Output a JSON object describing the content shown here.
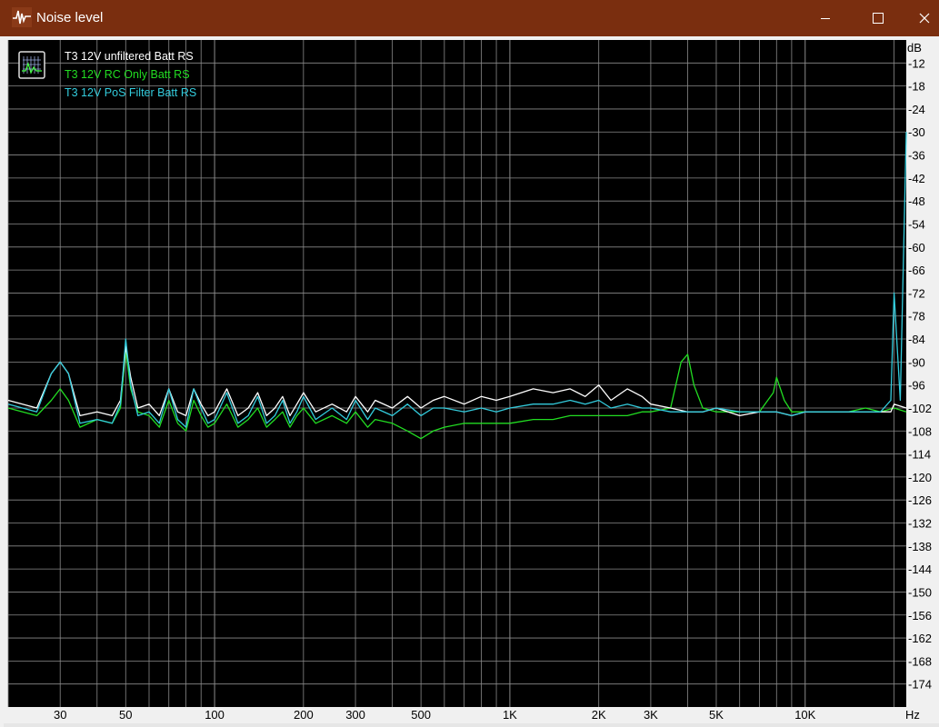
{
  "window": {
    "title": "Noise level",
    "minimize_glyph": "minimize-icon",
    "maximize_glyph": "maximize-icon",
    "close_glyph": "close-icon",
    "app_icon": "waveform-icon"
  },
  "colors": {
    "titlebar": "#7a2e0f",
    "plot_bg": "#000000",
    "grid": "#8a8a8a",
    "unfiltered": "#ffffff",
    "rc_only": "#22dd22",
    "pos_filter": "#33ccdd"
  },
  "chart_data": {
    "type": "line",
    "title": "",
    "xscale": "log",
    "xlim": [
      20,
      22000
    ],
    "ylim": [
      -180,
      -6
    ],
    "xunit": "Hz",
    "yunit": "dB",
    "legend_position": "top-left",
    "grid": true,
    "x_ticks": [
      30,
      50,
      100,
      200,
      300,
      500,
      1000,
      2000,
      3000,
      5000,
      10000
    ],
    "x_tick_labels": [
      "30",
      "50",
      "100",
      "200",
      "300",
      "500",
      "1K",
      "2K",
      "3K",
      "5K",
      "10K"
    ],
    "y_ticks": [
      -12,
      -18,
      -24,
      -30,
      -36,
      -42,
      -48,
      -54,
      -60,
      -66,
      -72,
      -78,
      -84,
      -90,
      -96,
      -102,
      -108,
      -114,
      -120,
      -126,
      -132,
      -138,
      -144,
      -150,
      -156,
      -162,
      -168,
      -174
    ],
    "series": [
      {
        "name": "T3 12V unfiltered Batt RS",
        "color": "#ffffff",
        "x": [
          20,
          25,
          28,
          30,
          32,
          35,
          40,
          45,
          48,
          50,
          52,
          55,
          60,
          65,
          70,
          75,
          80,
          85,
          90,
          95,
          100,
          110,
          120,
          130,
          140,
          150,
          160,
          170,
          180,
          190,
          200,
          220,
          250,
          280,
          300,
          330,
          350,
          400,
          450,
          500,
          550,
          600,
          700,
          800,
          900,
          1000,
          1200,
          1400,
          1600,
          1800,
          2000,
          2200,
          2500,
          2800,
          3000,
          3500,
          4000,
          4500,
          5000,
          6000,
          7000,
          8000,
          9000,
          10000,
          12000,
          14000,
          16000,
          18000,
          19500,
          20000,
          22000
        ],
        "y": [
          -100,
          -102,
          -93,
          -90,
          -93,
          -104,
          -103,
          -104,
          -100,
          -86,
          -94,
          -102,
          -101,
          -104,
          -97,
          -103,
          -104,
          -97,
          -101,
          -104,
          -103,
          -97,
          -104,
          -102,
          -98,
          -104,
          -102,
          -99,
          -104,
          -101,
          -98,
          -103,
          -101,
          -103,
          -99,
          -103,
          -100,
          -102,
          -99,
          -102,
          -100,
          -99,
          -101,
          -99,
          -100,
          -99,
          -97,
          -98,
          -97,
          -99,
          -96,
          -100,
          -97,
          -99,
          -101,
          -102,
          -103,
          -103,
          -102,
          -104,
          -103,
          -103,
          -104,
          -103,
          -103,
          -103,
          -103,
          -103,
          -103,
          -101,
          -102
        ]
      },
      {
        "name": "T3 12V RC Only Batt RS",
        "color": "#22dd22",
        "x": [
          20,
          25,
          28,
          30,
          32,
          35,
          40,
          45,
          48,
          50,
          52,
          55,
          60,
          65,
          70,
          75,
          80,
          85,
          90,
          95,
          100,
          110,
          120,
          130,
          140,
          150,
          160,
          170,
          180,
          190,
          200,
          220,
          250,
          280,
          300,
          330,
          350,
          400,
          450,
          500,
          550,
          600,
          700,
          800,
          900,
          1000,
          1200,
          1400,
          1600,
          1800,
          2000,
          2200,
          2500,
          2800,
          3000,
          3500,
          3800,
          4000,
          4200,
          4500,
          5000,
          6000,
          7000,
          7800,
          8000,
          8500,
          9000,
          10000,
          12000,
          14000,
          16000,
          18000,
          20000,
          22000
        ],
        "y": [
          -102,
          -104,
          -100,
          -97,
          -100,
          -107,
          -105,
          -106,
          -102,
          -87,
          -97,
          -103,
          -104,
          -107,
          -100,
          -106,
          -108,
          -100,
          -104,
          -107,
          -106,
          -101,
          -107,
          -105,
          -102,
          -107,
          -105,
          -103,
          -107,
          -104,
          -102,
          -106,
          -104,
          -106,
          -103,
          -107,
          -105,
          -106,
          -108,
          -110,
          -108,
          -107,
          -106,
          -106,
          -106,
          -106,
          -105,
          -105,
          -104,
          -104,
          -104,
          -104,
          -104,
          -103,
          -103,
          -102,
          -90,
          -88,
          -96,
          -102,
          -103,
          -103,
          -103,
          -98,
          -94,
          -100,
          -103,
          -103,
          -103,
          -103,
          -102,
          -103,
          -102,
          -103
        ]
      },
      {
        "name": "T3 12V PoS Filter Batt RS",
        "color": "#33ccdd",
        "x": [
          20,
          25,
          28,
          30,
          32,
          35,
          40,
          45,
          48,
          50,
          52,
          55,
          60,
          65,
          70,
          75,
          80,
          85,
          90,
          95,
          100,
          110,
          120,
          130,
          140,
          150,
          160,
          170,
          180,
          190,
          200,
          220,
          250,
          280,
          300,
          330,
          350,
          400,
          450,
          500,
          550,
          600,
          700,
          800,
          900,
          1000,
          1200,
          1400,
          1600,
          1800,
          2000,
          2200,
          2500,
          2800,
          3000,
          3500,
          4000,
          4500,
          5000,
          6000,
          7000,
          8000,
          9000,
          10000,
          12000,
          14000,
          16000,
          18000,
          19500,
          20000,
          21000,
          22000
        ],
        "y": [
          -101,
          -103,
          -93,
          -90,
          -93,
          -106,
          -105,
          -106,
          -101,
          -84,
          -96,
          -104,
          -103,
          -106,
          -97,
          -105,
          -107,
          -97,
          -102,
          -106,
          -105,
          -98,
          -106,
          -104,
          -99,
          -106,
          -104,
          -100,
          -106,
          -103,
          -99,
          -105,
          -102,
          -105,
          -100,
          -105,
          -102,
          -104,
          -101,
          -104,
          -102,
          -102,
          -103,
          -102,
          -103,
          -102,
          -101,
          -101,
          -100,
          -101,
          -100,
          -102,
          -101,
          -102,
          -102,
          -103,
          -103,
          -103,
          -102,
          -103,
          -103,
          -103,
          -104,
          -103,
          -103,
          -103,
          -103,
          -103,
          -100,
          -72,
          -100,
          -30
        ]
      }
    ]
  }
}
